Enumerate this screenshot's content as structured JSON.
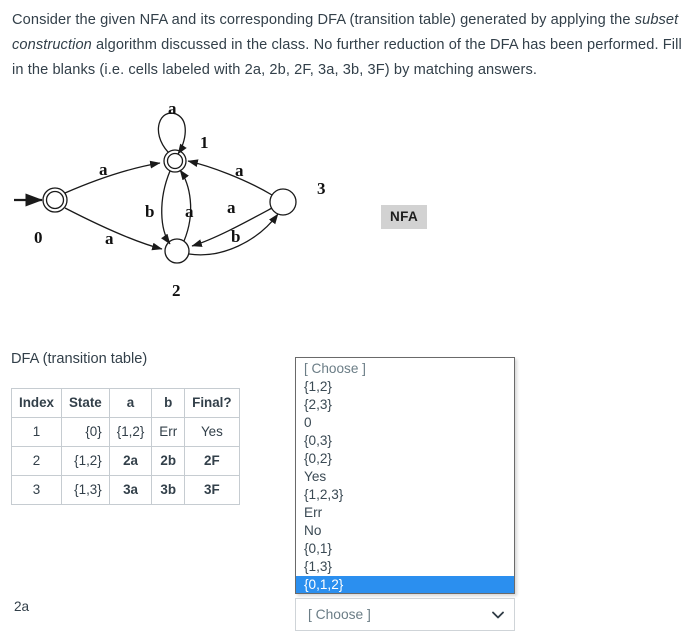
{
  "question": {
    "line1_a": "Consider the given NFA and its corresponding DFA (transition table) generated by applying the",
    "line2_em": "subset construction",
    "line2_b": " algorithm discussed in the class. No further reduction of the DFA has been",
    "line3": "performed. Fill in the blanks (i.e. cells labeled with 2a, 2b, 2F, 3a, 3b, 3F) by matching answers."
  },
  "figure": {
    "badge": "NFA",
    "states": [
      {
        "id": "0",
        "label": "0",
        "accepting": true
      },
      {
        "id": "1",
        "label": "1",
        "accepting": true
      },
      {
        "id": "2",
        "label": "2",
        "accepting": false
      },
      {
        "id": "3",
        "label": "3",
        "accepting": false
      }
    ],
    "edge_labels": {
      "self_loop_1": "a",
      "zero_to_one": "a",
      "zero_to_two": "a",
      "one_to_two": "b",
      "two_to_one": "a",
      "three_to_one": "a",
      "three_to_two": "a",
      "two_to_three": "b"
    }
  },
  "dfa": {
    "heading": "DFA (transition table)",
    "headers": [
      "Index",
      "State",
      "a",
      "b",
      "Final?"
    ],
    "rows": [
      {
        "index": "1",
        "state": "{0}",
        "a": "{1,2}",
        "b": "Err",
        "final": "Yes"
      },
      {
        "index": "2",
        "state": "{1,2}",
        "a": "2a",
        "b": "2b",
        "final": "2F"
      },
      {
        "index": "3",
        "state": "{1,3}",
        "a": "3a",
        "b": "3b",
        "final": "3F"
      }
    ]
  },
  "choices": {
    "items": [
      "[ Choose ]",
      "{1,2}",
      "{2,3}",
      "0",
      "{0,3}",
      "{0,2}",
      "Yes",
      "{1,2,3}",
      "Err",
      "No",
      "{0,1}",
      "{1,3}",
      "{0,1,2}"
    ],
    "selected_index": 12,
    "highlight_color": "#2b8fef"
  },
  "answer_row": {
    "label": "2a",
    "select_value": "[ Choose ]",
    "chevron": "⌄"
  }
}
